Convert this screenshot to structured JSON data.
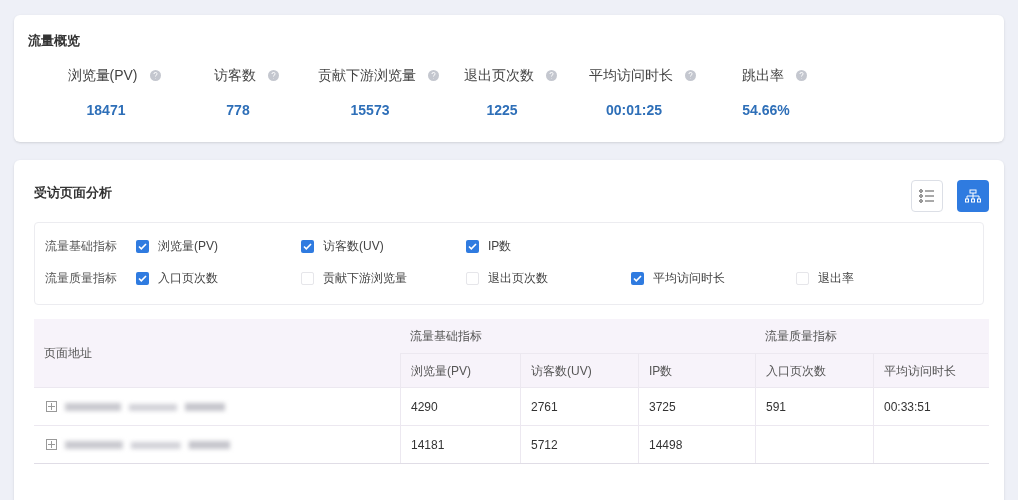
{
  "overview": {
    "title": "流量概览",
    "metrics": [
      {
        "label": "浏览量(PV)",
        "value": "18471"
      },
      {
        "label": "访客数",
        "value": "778"
      },
      {
        "label": "贡献下游浏览量",
        "value": "15573"
      },
      {
        "label": "退出页次数",
        "value": "1225"
      },
      {
        "label": "平均访问时长",
        "value": "00:01:25"
      },
      {
        "label": "跳出率",
        "value": "54.66%"
      }
    ]
  },
  "analysis": {
    "title": "受访页面分析",
    "view_buttons": [
      {
        "kind": "list",
        "selected": false
      },
      {
        "kind": "tree",
        "selected": true
      }
    ],
    "filter_groups": [
      {
        "label": "流量基础指标",
        "options": [
          {
            "label": "浏览量(PV)",
            "checked": true
          },
          {
            "label": "访客数(UV)",
            "checked": true
          },
          {
            "label": "IP数",
            "checked": true
          }
        ]
      },
      {
        "label": "流量质量指标",
        "options": [
          {
            "label": "入口页次数",
            "checked": true
          },
          {
            "label": "贡献下游浏览量",
            "checked": false
          },
          {
            "label": "退出页次数",
            "checked": false
          },
          {
            "label": "平均访问时长",
            "checked": true
          },
          {
            "label": "退出率",
            "checked": false
          }
        ]
      }
    ],
    "table": {
      "address_header": "页面地址",
      "groups": [
        {
          "label": "流量基础指标",
          "columns": [
            "浏览量(PV)",
            "访客数(UV)",
            "IP数"
          ]
        },
        {
          "label": "流量质量指标",
          "columns": [
            "入口页次数",
            "平均访问时长"
          ]
        }
      ],
      "rows": [
        {
          "cells": [
            "4290",
            "2761",
            "3725",
            "591",
            "00:33:51"
          ]
        },
        {
          "cells": [
            "14181",
            "5712",
            "14498"
          ]
        }
      ]
    }
  }
}
